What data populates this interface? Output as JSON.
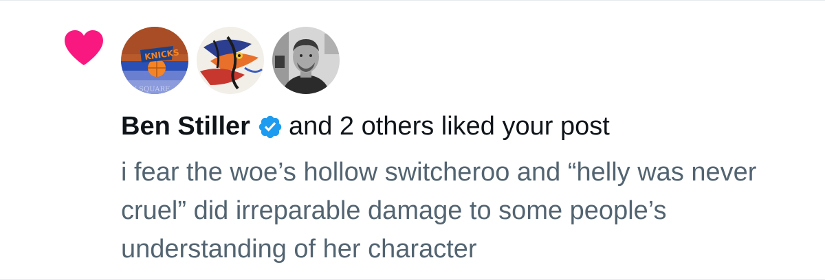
{
  "notification": {
    "type": "like",
    "icon": "heart-icon",
    "accent_color": "#f91880",
    "verified_color": "#1d9bf0",
    "user_name": "Ben Stiller",
    "action_text": "and 2 others liked your post",
    "post_text": "i fear the woe’s hollow switcheroo and “helly was never cruel” did irreparable damage to some people’s understanding of her character",
    "avatars": [
      {
        "name": "knicks-avatar"
      },
      {
        "name": "tiger-art-avatar"
      },
      {
        "name": "ben-stiller-avatar"
      }
    ]
  }
}
